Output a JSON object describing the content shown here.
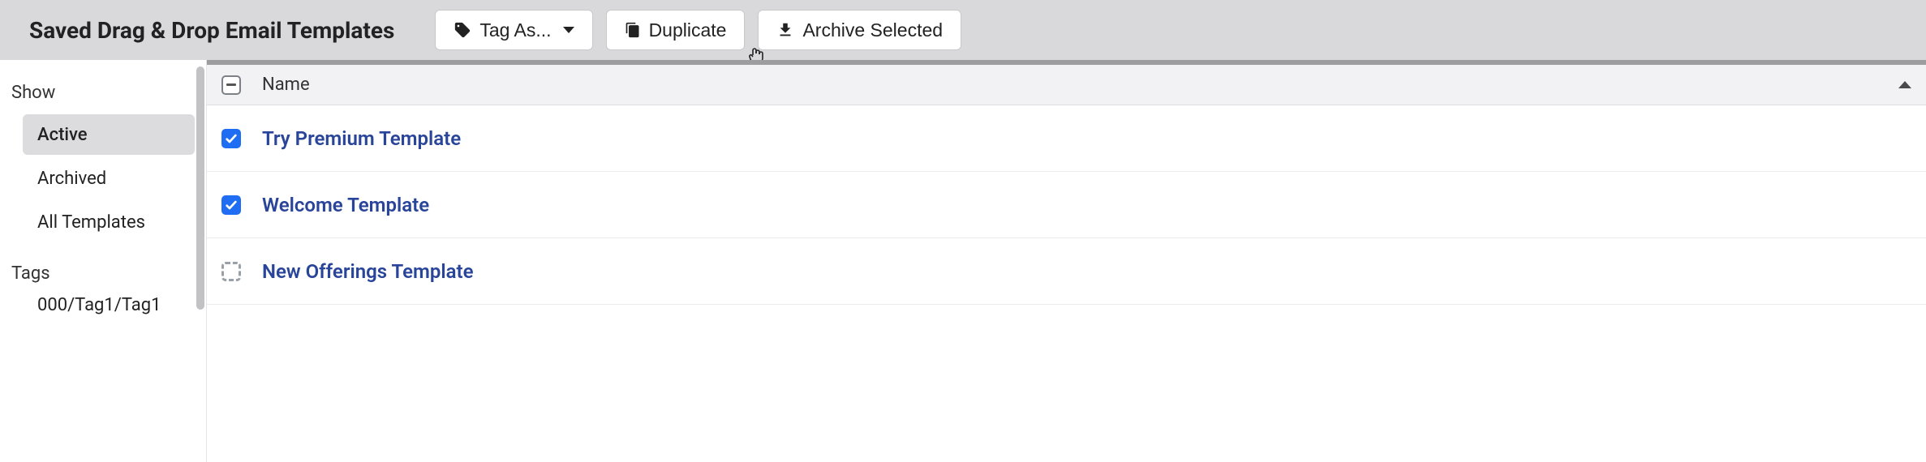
{
  "header": {
    "title": "Saved Drag & Drop Email Templates",
    "tag_as_label": "Tag As...",
    "duplicate_label": "Duplicate",
    "archive_label": "Archive Selected"
  },
  "sidebar": {
    "show_heading": "Show",
    "items": [
      {
        "label": "Active",
        "active": true
      },
      {
        "label": "Archived",
        "active": false
      },
      {
        "label": "All Templates",
        "active": false
      }
    ],
    "tags_heading": "Tags",
    "tags": [
      {
        "label": "000/Tag1/Tag1"
      }
    ]
  },
  "table": {
    "header": {
      "name_label": "Name",
      "select_state": "indeterminate",
      "sort_dir": "asc"
    },
    "rows": [
      {
        "name": "Try Premium Template",
        "checked": true
      },
      {
        "name": "Welcome Template",
        "checked": true
      },
      {
        "name": "New Offerings Template",
        "checked": false
      }
    ]
  }
}
